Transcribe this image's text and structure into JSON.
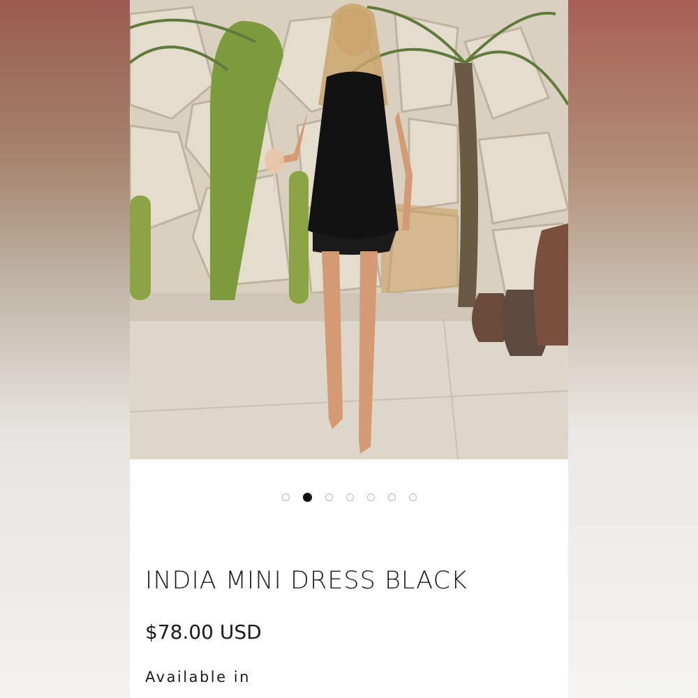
{
  "product": {
    "title": "INDIA MINI DRESS BLACK",
    "price": "$78.00 USD",
    "availability_label": "Available in"
  },
  "carousel": {
    "total_slides": 7,
    "active_index": 1
  },
  "colors": {
    "page_background": "#ffffff",
    "text": "#1b1b1b",
    "dot_active": "#111111",
    "dot_inactive": "#b8b8b8"
  }
}
